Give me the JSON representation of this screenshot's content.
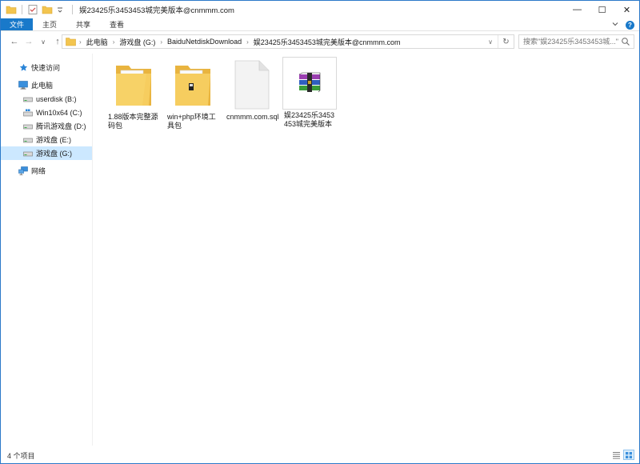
{
  "window": {
    "title": "娱23425乐3453453城完美版本@cnmmm.com",
    "controls": {
      "minimize": "—",
      "maximize": "☐",
      "close": "✕"
    }
  },
  "ribbon": {
    "tabs": [
      "文件",
      "主页",
      "共享",
      "查看"
    ],
    "expand_icon": "chevron-down-icon",
    "help_label": "?"
  },
  "navigation": {
    "back": "←",
    "forward": "→",
    "recent": "∨",
    "up": "↑"
  },
  "address": {
    "crumbs": [
      "此电脑",
      "游戏盘 (G:)",
      "BaiduNetdiskDownload",
      "娱23425乐3453453城完美版本@cnmmm.com"
    ]
  },
  "search": {
    "placeholder": "搜索\"娱23425乐3453453城...\""
  },
  "sidebar": {
    "items": [
      {
        "label": "快速访问",
        "icon": "star-icon",
        "level": 0
      },
      {
        "label": "此电脑",
        "icon": "computer-icon",
        "level": 0
      },
      {
        "label": "userdisk (B:)",
        "icon": "drive-icon",
        "level": 1
      },
      {
        "label": "Win10x64 (C:)",
        "icon": "drive-icon",
        "level": 1
      },
      {
        "label": "腾讯游戏盘 (D:)",
        "icon": "drive-icon",
        "level": 1
      },
      {
        "label": "游戏盘 (E:)",
        "icon": "drive-icon",
        "level": 1
      },
      {
        "label": "游戏盘 (G:)",
        "icon": "drive-icon",
        "level": 1,
        "selected": true
      },
      {
        "label": "网络",
        "icon": "network-icon",
        "level": 0
      }
    ]
  },
  "files": [
    {
      "name": "1.88版本完整源码包",
      "type": "folder"
    },
    {
      "name": "win+php环境工具包",
      "type": "folder"
    },
    {
      "name": "cnmmm.com.sql",
      "type": "file"
    },
    {
      "name": "娱23425乐3453453城完美版本",
      "type": "archive"
    }
  ],
  "status": {
    "item_count": "4 个项目"
  },
  "colors": {
    "accent": "#1979ca",
    "selected": "#cce8ff",
    "folder": "#f3c54f"
  }
}
